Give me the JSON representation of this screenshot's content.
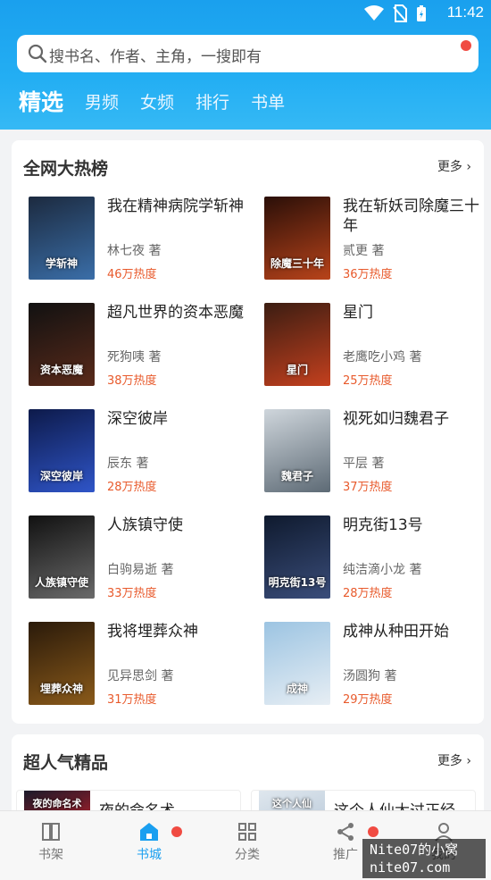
{
  "status_bar": {
    "time": "11:42"
  },
  "search": {
    "placeholder": "搜书名、作者、主角，一搜即有"
  },
  "tabs": [
    "精选",
    "男频",
    "女频",
    "排行",
    "书单"
  ],
  "hot_section": {
    "title": "全网大热榜",
    "more": "更多",
    "books": [
      {
        "title": "我在精神病院学斩神",
        "author": "林七夜 著",
        "heat": "46万热度",
        "cover_colors": [
          "#1c2a3f",
          "#3a6ea8"
        ],
        "cover_text": "学斩神"
      },
      {
        "title": "我在斩妖司除魔三十年",
        "author": "贰更 著",
        "heat": "36万热度",
        "cover_colors": [
          "#2a0f08",
          "#b8431a"
        ],
        "cover_text": "除魔三十年"
      },
      {
        "title": "超凡世界的资本恶魔",
        "author": "死狗咦 著",
        "heat": "38万热度",
        "cover_colors": [
          "#111111",
          "#5a2a1a"
        ],
        "cover_text": "资本恶魔"
      },
      {
        "title": "星门",
        "author": "老鹰吃小鸡 著",
        "heat": "25万热度",
        "cover_colors": [
          "#3b1d12",
          "#c4401e"
        ],
        "cover_text": "星门"
      },
      {
        "title": "深空彼岸",
        "author": "辰东 著",
        "heat": "28万热度",
        "cover_colors": [
          "#0d1a4a",
          "#2f55c8"
        ],
        "cover_text": "深空彼岸"
      },
      {
        "title": "视死如归魏君子",
        "author": "平层 著",
        "heat": "37万热度",
        "cover_colors": [
          "#cfd6dc",
          "#5d6a75"
        ],
        "cover_text": "魏君子"
      },
      {
        "title": "人族镇守使",
        "author": "白驹易逝 著",
        "heat": "33万热度",
        "cover_colors": [
          "#111111",
          "#6a6a6a"
        ],
        "cover_text": "人族镇守使"
      },
      {
        "title": "明克街13号",
        "author": "纯洁滴小龙 著",
        "heat": "28万热度",
        "cover_colors": [
          "#0f1a2e",
          "#3a4d7a"
        ],
        "cover_text": "明克街13号"
      },
      {
        "title": "我将埋葬众神",
        "author": "见异思剑 著",
        "heat": "31万热度",
        "cover_colors": [
          "#2a1a0a",
          "#8a5a1a"
        ],
        "cover_text": "埋葬众神"
      },
      {
        "title": "成神从种田开始",
        "author": "汤圆狗 著",
        "heat": "29万热度",
        "cover_colors": [
          "#9cc4e2",
          "#e7eef4"
        ],
        "cover_text": "成神"
      }
    ]
  },
  "popular_section": {
    "title": "超人气精品",
    "more": "更多",
    "books": [
      {
        "title": "夜的命名术",
        "cover_colors": [
          "#1a1a2a",
          "#c8202a"
        ],
        "cover_text": "夜的命名术"
      },
      {
        "title": "这个人仙太过正经",
        "cover_colors": [
          "#dfe7ee",
          "#b8c8d8"
        ],
        "cover_text": "这个人仙"
      }
    ]
  },
  "bottom_nav": [
    {
      "label": "书架",
      "icon": "bookshelf-icon"
    },
    {
      "label": "书城",
      "icon": "home-icon"
    },
    {
      "label": "分类",
      "icon": "category-icon"
    },
    {
      "label": "推广",
      "icon": "share-icon"
    },
    {
      "label": "我的",
      "icon": "user-icon"
    }
  ],
  "watermark": {
    "line1": "Nite07的小窝",
    "line2": "nite07.com"
  },
  "colors": {
    "accent": "#1a9ff0",
    "heat": "#e85a2c",
    "badge": "#f04b42"
  }
}
